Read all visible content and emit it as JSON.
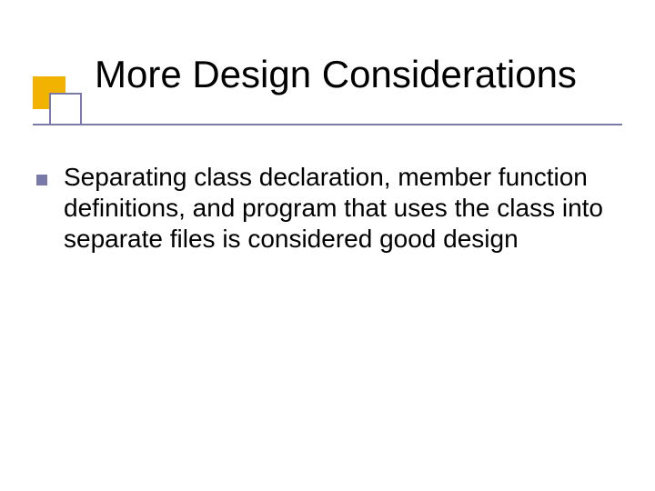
{
  "slide": {
    "title": "More Design Considerations",
    "bullets": [
      {
        "text": "Separating class declaration, member function definitions, and program that uses the class into separate files is considered good design"
      }
    ]
  },
  "theme": {
    "accent_square": "#f2b200",
    "border_color": "#7a7aa8",
    "bullet_color": "#7a7aa8",
    "underline_color": "#7a7aa8"
  }
}
